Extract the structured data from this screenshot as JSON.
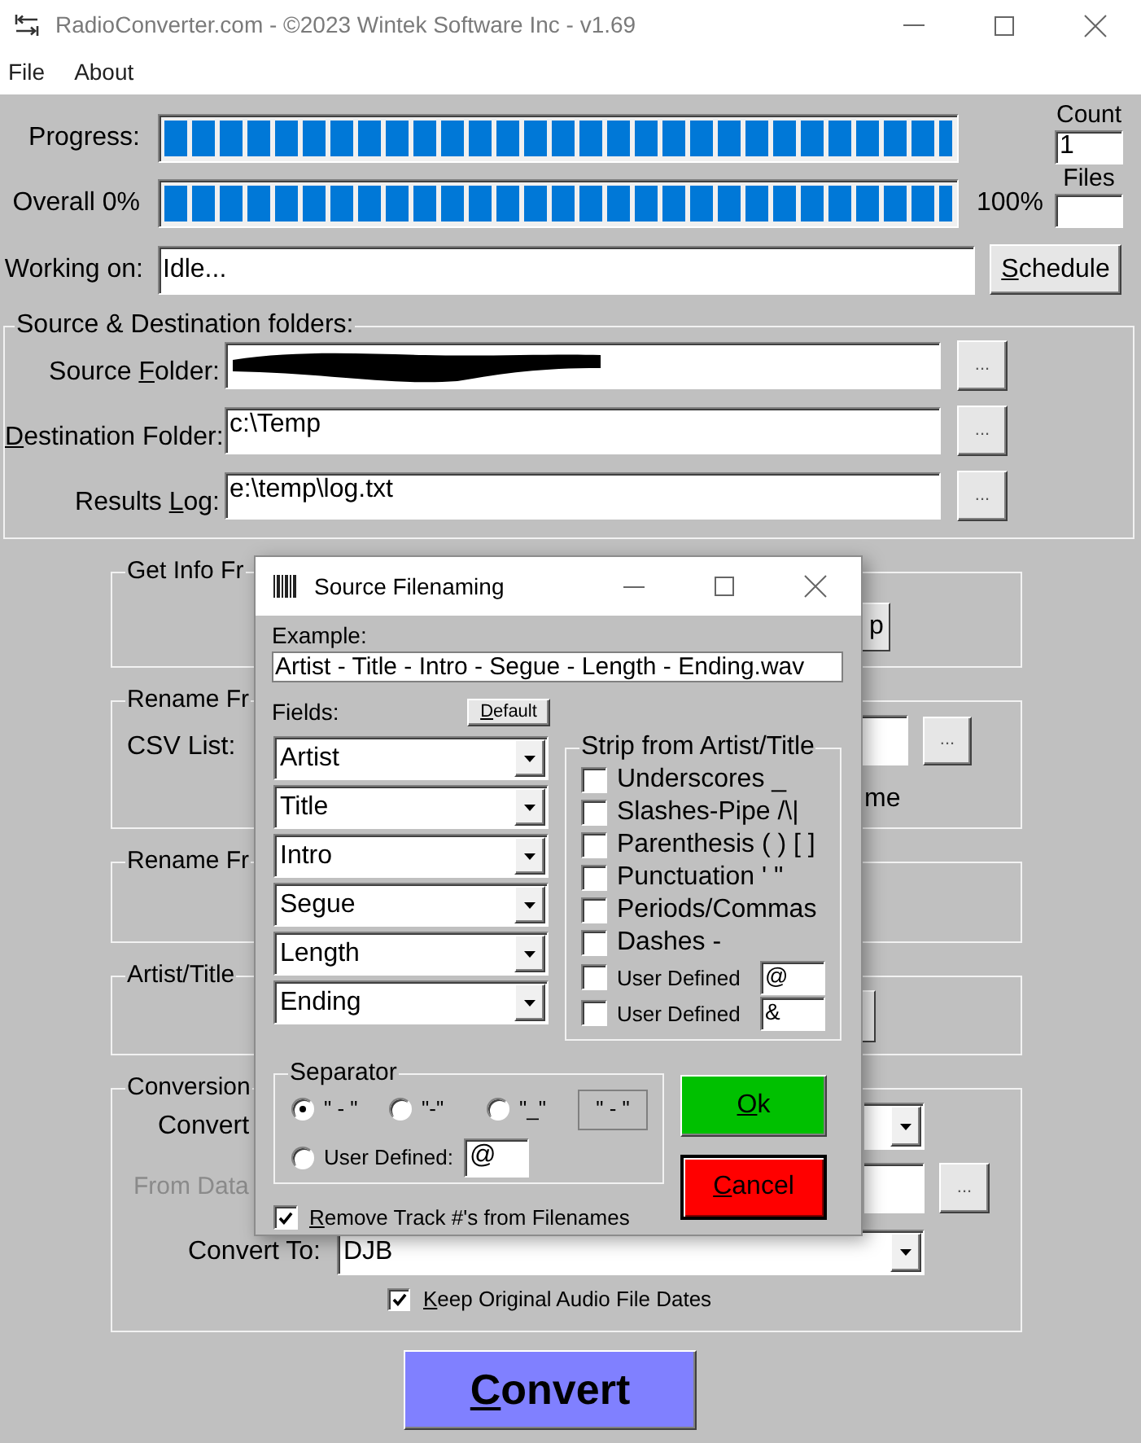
{
  "window": {
    "title": "RadioConverter.com - ©2023 Wintek Software Inc - v1.69"
  },
  "menu": [
    {
      "label": "File"
    },
    {
      "label": "About"
    }
  ],
  "progress": [
    {
      "label": "Progress:",
      "level": 1
    },
    {
      "label": "Overall 0%",
      "level": 1,
      "end_label": "100%"
    }
  ],
  "counters": [
    {
      "label": "Count",
      "value": "1"
    },
    {
      "label": "Files"
    }
  ],
  "working_on": {
    "label": "Working on:",
    "value": "Idle..."
  },
  "schedule_button": {
    "key": "S",
    "after": "chedule"
  },
  "folders": {
    "title": "Source & Destination folders:",
    "rows": [
      {
        "label": {
          "before": "Source ",
          "key": "F",
          "after": "older:"
        },
        "redacted": true,
        "browse": "..."
      },
      {
        "label": {
          "key": "D",
          "after": "estination Folder:"
        },
        "value": "c:\\Temp",
        "redacted": false,
        "browse": "..."
      },
      {
        "label": {
          "before": "Results ",
          "key": "L",
          "after": "og:"
        },
        "value": "e:\\temp\\log.txt",
        "redacted": false,
        "browse": "..."
      }
    ]
  },
  "groups": [
    {
      "kind": "button",
      "title": "Get Info Fr",
      "button": "p"
    },
    {
      "kind": "file",
      "title": "Rename Fr",
      "label": "CSV List:",
      "browse": "...",
      "note": "me"
    },
    {
      "kind": "empty",
      "title": "Rename Fr"
    },
    {
      "kind": "stub",
      "title": "Artist/Title"
    }
  ],
  "conversion": {
    "title": "Conversion",
    "convert_label": "Convert",
    "from_label": "From Data",
    "from_disabled": true,
    "from_browse": "...",
    "convert_to_label": "Convert To:",
    "convert_to_value": "DJB",
    "keep_dates": {
      "label": {
        "key": "K",
        "after": "eep Original Audio File Dates"
      },
      "checked": true
    }
  },
  "convert_button": {
    "key": "C",
    "after": "onvert"
  },
  "dialog": {
    "title": "Source Filenaming",
    "example_label": "Example:",
    "example": "Artist - Title - Intro - Segue - Length - Ending.wav",
    "fields_label": "Fields:",
    "default_button": {
      "key": "D",
      "after": "efault"
    },
    "fields": [
      "Artist",
      "Title",
      "Intro",
      "Segue",
      "Length",
      "Ending"
    ],
    "strip": {
      "title": "Strip from Artist/Title",
      "options": [
        {
          "kind": "fixed",
          "label": "Underscores _",
          "checked": false
        },
        {
          "kind": "fixed",
          "label": "Slashes-Pipe /\\|",
          "checked": false
        },
        {
          "kind": "fixed",
          "label": "Parenthesis ( ) [ ]",
          "checked": false
        },
        {
          "kind": "fixed",
          "label": "Punctuation ' \"",
          "checked": false
        },
        {
          "kind": "fixed",
          "label": "Periods/Commas",
          "checked": false
        },
        {
          "kind": "fixed",
          "label": "Dashes -",
          "checked": false
        },
        {
          "kind": "custom",
          "label": "User Defined",
          "checked": false,
          "value": "@"
        },
        {
          "kind": "custom",
          "label": "User Defined",
          "checked": false,
          "value": "&"
        }
      ]
    },
    "separator": {
      "title": "Separator",
      "options": [
        {
          "kind": "preset",
          "label": "\" - \"",
          "selected": true
        },
        {
          "kind": "preset",
          "label": "\"-\"",
          "selected": false
        },
        {
          "kind": "preset",
          "label": "\"_\"",
          "selected": false
        },
        {
          "kind": "custom",
          "label": "User Defined:",
          "selected": false,
          "value": "@"
        }
      ],
      "preview": "\" - \""
    },
    "remove_track": {
      "label": {
        "key": "R",
        "after": "emove Track #'s from Filenames"
      },
      "checked": true
    },
    "buttons": [
      {
        "label": {
          "key": "O",
          "after": "k"
        },
        "color": "#00c000",
        "focused": false
      },
      {
        "label": {
          "key": "C",
          "after": "ancel"
        },
        "color": "#ff0000",
        "focused": true
      }
    ]
  }
}
